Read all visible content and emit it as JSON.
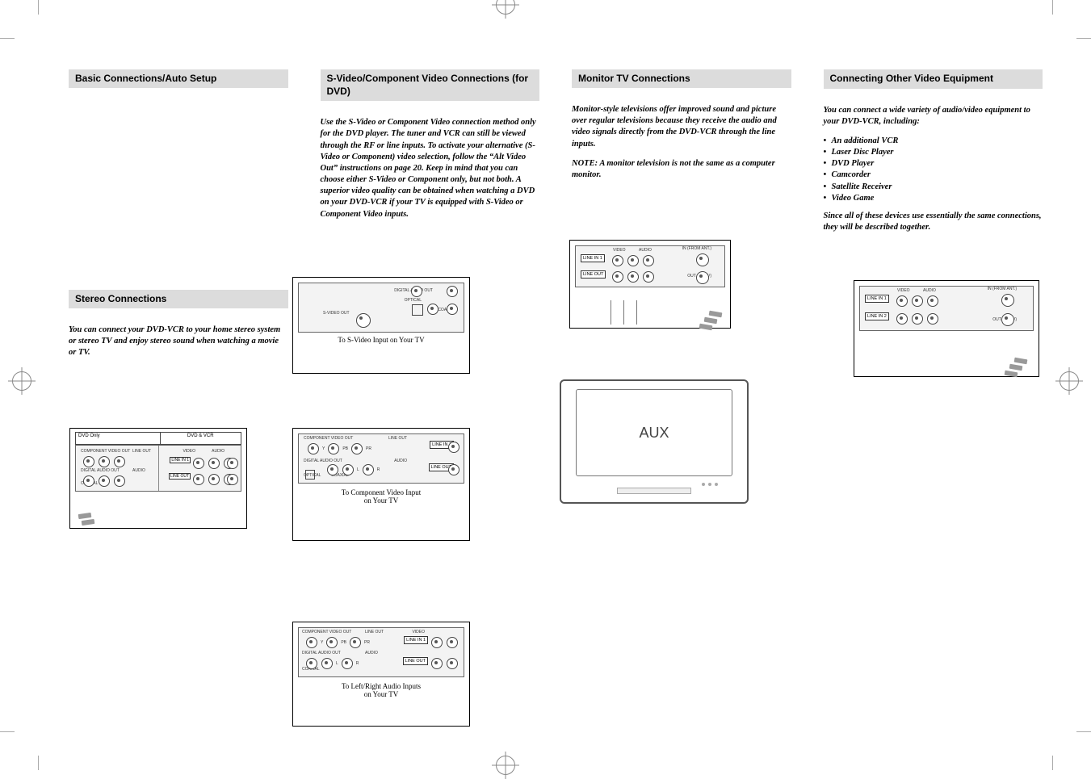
{
  "sections": {
    "basic": {
      "title": "Basic Connections/Auto Setup"
    },
    "svideo": {
      "title": "S-Video/Component Video Connections (for DVD)",
      "body": "Use the S-Video or Component Video connection method only for the DVD player. The tuner and VCR can still be viewed through the RF or line inputs. To activate your alternative (S-Video or Component) video selection, follow the “Alt Video Out” instructions on page 20. Keep in mind that you can choose either S-Video or Component only, but not both. A superior video quality can be obtained when watching a DVD on your DVD-VCR if your TV is equipped with S-Video or Component Video inputs."
    },
    "stereo": {
      "title": "Stereo Connections",
      "body": "You can connect your DVD-VCR to your home stereo system or stereo TV and enjoy stereo sound when watching a movie or TV."
    },
    "monitor": {
      "title": "Monitor TV Connections",
      "body": "Monitor-style televisions offer improved sound and picture over regular televisions because they receive the audio and video signals directly from the DVD-VCR through the line inputs.",
      "note_label": "NOTE:",
      "note_body": "A monitor television is not the same as a computer monitor."
    },
    "other": {
      "title": "Connecting Other Video Equipment",
      "intro": "You can connect a wide variety of audio/video equipment to your DVD-VCR, including:",
      "items": [
        "An additional VCR",
        "Laser Disc Player",
        "DVD Player",
        "Camcorder",
        "Satellite Receiver",
        "Video Game"
      ],
      "outro": "Since all of these devices use essentially the same connections, they will be described together."
    }
  },
  "figures": {
    "f1_cap": "To S-Video Input on Your TV",
    "f2_cap1": "To Component Video Input",
    "f2_cap2": "on Your TV",
    "f3_cap1": "To Left/Right Audio Inputs",
    "f3_cap2": "on Your TV",
    "tv_text": "AUX",
    "panel_labels": {
      "dvd_only": "DVD Only",
      "dvd_vcr": "DVD & VCR",
      "component": "COMPONENT VIDEO OUT",
      "digital_audio": "DIGITAL AUDIO OUT",
      "svideo_out": "S-VIDEO OUT",
      "optical": "OPTICAL",
      "coaxial": "COAXIAL",
      "line_in1": "LINE IN 1",
      "line_out": "LINE OUT",
      "line_in2": "LINE IN 2",
      "video": "VIDEO",
      "audio": "AUDIO",
      "line1": "LINE OUT",
      "ant_in": "IN (FROM ANT.)",
      "ant_out": "OUT (TO TV)",
      "y": "Y",
      "pb": "PB",
      "pr": "PR",
      "l": "L",
      "r": "R"
    }
  }
}
